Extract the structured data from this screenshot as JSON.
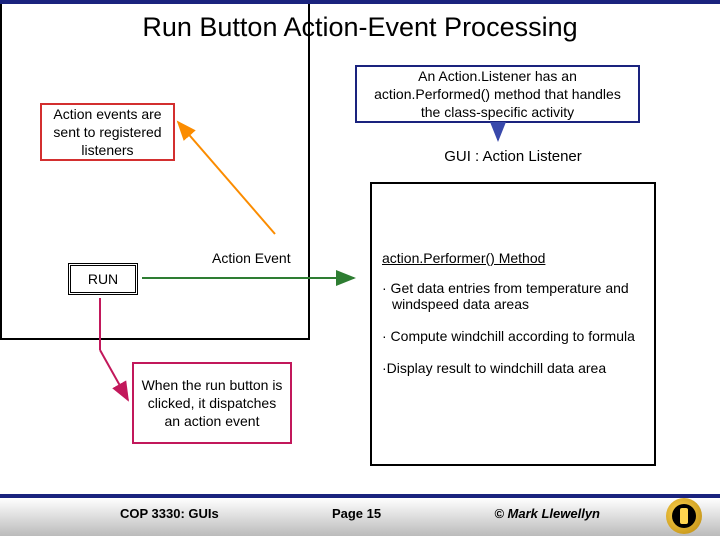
{
  "title": "Run Button Action-Event Processing",
  "boxes": {
    "events_sent": "Action events are sent to registered listeners",
    "listener_desc": "An Action.Listener has an action.Performed() method that handles the class-specific activity",
    "gui_title": "GUI : Action Listener",
    "method_name": "action.Performer() Method",
    "bullet1": "· Get data entries from temperature and windspeed data areas",
    "bullet2": "· Compute windchill according to formula",
    "bullet3": "·Display result to windchill data area",
    "run": "RUN",
    "action_event": "Action Event",
    "dispatch": "When the run button is clicked, it dispatches an action event"
  },
  "footer": {
    "course": "COP 3330:  GUIs",
    "page": "Page 15",
    "copy": "© Mark Llewellyn"
  }
}
